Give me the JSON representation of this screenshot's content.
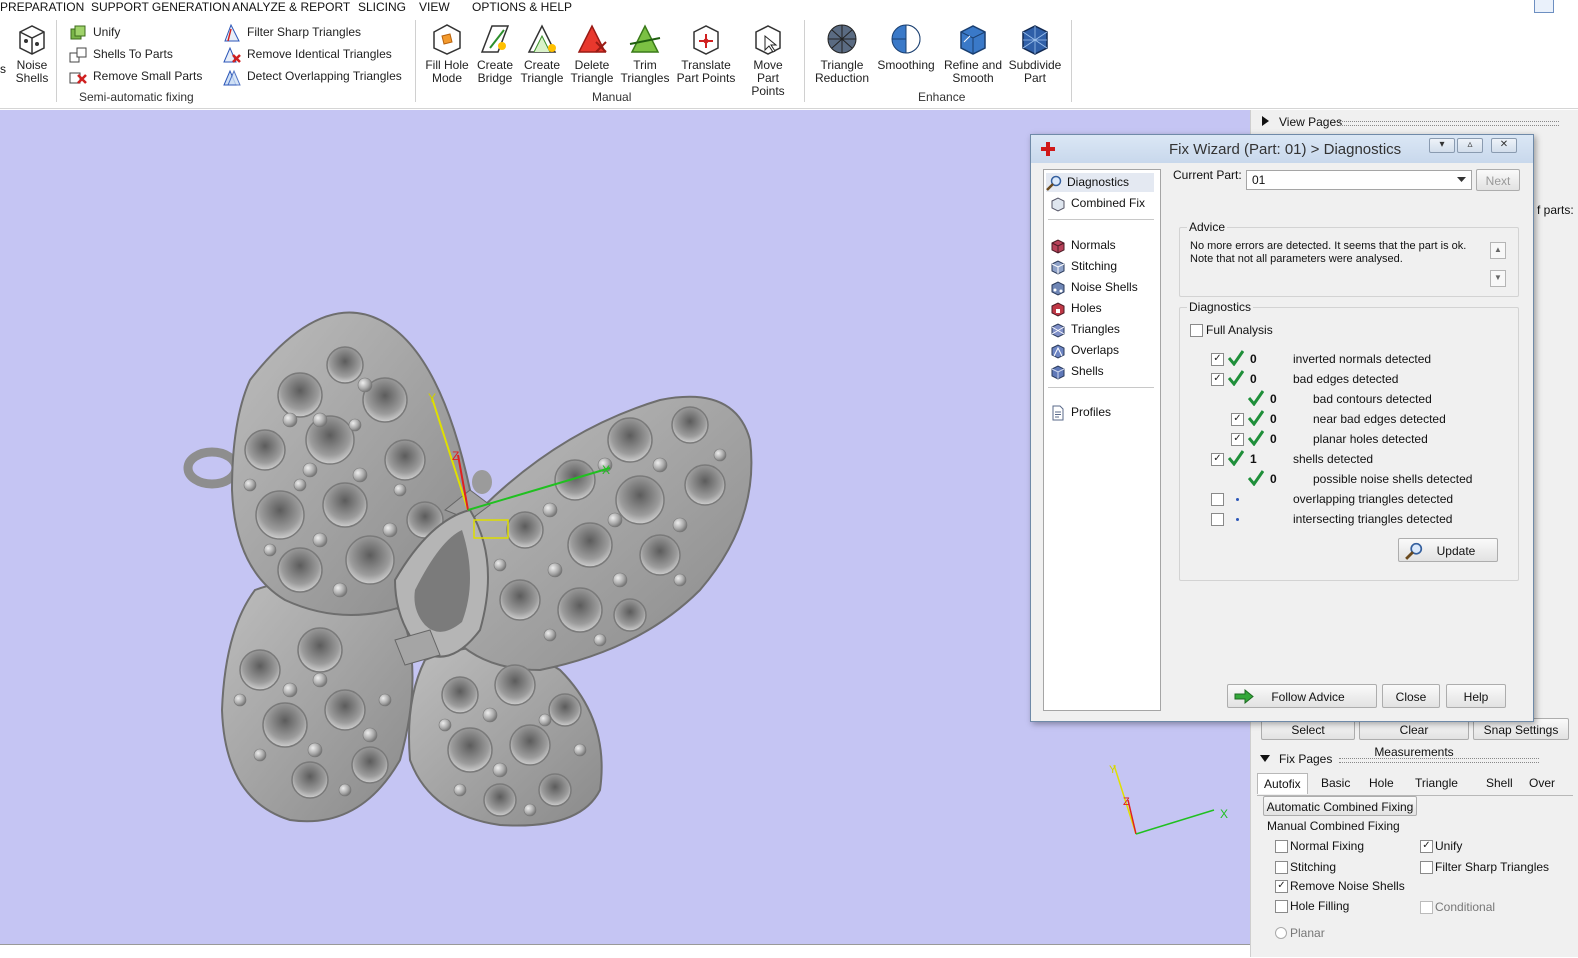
{
  "menu": [
    "PREPARATION",
    "SUPPORT GENERATION",
    "ANALYZE & REPORT",
    "SLICING",
    "VIEW",
    "OPTIONS & HELP"
  ],
  "ribbon": {
    "partial_left": "s",
    "noise_shells": "Noise\nShells",
    "semi_auto": {
      "label": "Semi-automatic fixing",
      "items": [
        "Unify",
        "Shells To Parts",
        "Remove Small Parts",
        "Filter Sharp Triangles",
        "Remove Identical Triangles",
        "Detect Overlapping Triangles"
      ]
    },
    "manual": {
      "label": "Manual",
      "items": [
        "Fill Hole\nMode",
        "Create\nBridge",
        "Create\nTriangle",
        "Delete\nTriangle",
        "Trim\nTriangles",
        "Translate\nPart Points",
        "Move Part\nPoints"
      ]
    },
    "enhance": {
      "label": "Enhance",
      "items": [
        "Triangle\nReduction",
        "Smoothing",
        "Refine and\nSmooth",
        "Subdivide\nPart"
      ]
    }
  },
  "dialog": {
    "title": "Fix Wizard (Part: 01) > Diagnostics",
    "nav": [
      "Diagnostics",
      "Combined Fix",
      "Normals",
      "Stitching",
      "Noise Shells",
      "Holes",
      "Triangles",
      "Overlaps",
      "Shells",
      "Profiles"
    ],
    "current_part_label": "Current Part:",
    "current_part_value": "01",
    "next_label": "Next",
    "advice_label": "Advice",
    "advice_text": "No more errors are detected. It seems that the part is ok.\nNote that not all parameters were analysed.",
    "diagnostics_label": "Diagnostics",
    "full_analysis_label": "Full Analysis",
    "rows": [
      {
        "checked": true,
        "ok": true,
        "count": "0",
        "label": "inverted normals detected"
      },
      {
        "checked": true,
        "ok": true,
        "count": "0",
        "label": "bad edges detected"
      },
      {
        "checked": null,
        "ok": true,
        "count": "0",
        "label": "bad contours detected"
      },
      {
        "checked": true,
        "ok": true,
        "count": "0",
        "label": "near bad edges detected"
      },
      {
        "checked": true,
        "ok": true,
        "count": "0",
        "label": "planar holes detected"
      },
      {
        "checked": true,
        "ok": true,
        "count": "1",
        "label": "shells detected"
      },
      {
        "checked": null,
        "ok": true,
        "count": "0",
        "label": "possible noise shells detected"
      },
      {
        "checked": false,
        "ok": false,
        "count": "",
        "label": "overlapping triangles detected"
      },
      {
        "checked": false,
        "ok": false,
        "count": "",
        "label": "intersecting triangles detected"
      }
    ],
    "update_label": "Update",
    "follow_advice_label": "Follow Advice",
    "close_label": "Close",
    "help_label": "Help"
  },
  "right_panel": {
    "view_pages": "View Pages",
    "parts_label": "f parts:",
    "buttons": [
      "Select",
      "Clear Measurements",
      "Snap Settings"
    ],
    "fix_pages": "Fix Pages",
    "tabs": [
      "Autofix",
      "Basic",
      "Hole",
      "Triangle",
      "Shell",
      "Over"
    ],
    "auto_combined": "Automatic Combined Fixing",
    "manual_combined": "Manual Combined Fixing",
    "options": [
      {
        "label": "Normal Fixing",
        "checked": false
      },
      {
        "label": "Unify",
        "checked": true
      },
      {
        "label": "Stitching",
        "checked": false
      },
      {
        "label": "Filter Sharp Triangles",
        "checked": false
      },
      {
        "label": "Remove Noise Shells",
        "checked": true
      },
      {
        "label": "Hole Filling",
        "checked": false
      },
      {
        "label": "Conditional",
        "checked": false
      }
    ],
    "planar_label": "Planar"
  },
  "colors": {
    "viewport": "#c5c5f3",
    "model": "#a9a9a9",
    "accent": "#2b56b8",
    "ok_green": "#1f8f3a"
  }
}
